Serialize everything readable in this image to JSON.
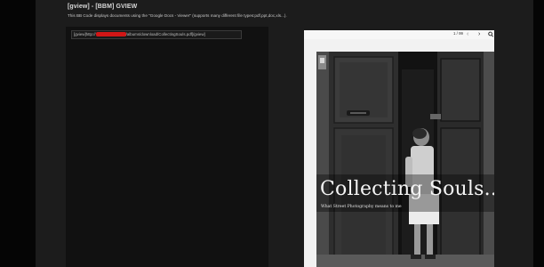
{
  "header": {
    "title": "[gview] - [BBM] GVIEW",
    "description": "This BB Code displays documents using the \"Google Docs - Viewer\" (supports many different file types:pdf,ppt,doc,xls...)."
  },
  "code_example": {
    "prefix": "[gview]http://",
    "suffix": "/albums/download/CollectingSouls.pdf[/gview]"
  },
  "viewer": {
    "page_count": "1 / 99",
    "prev_icon": "chevron-left-icon",
    "next_icon": "chevron-right-icon",
    "zoom_icon": "magnifier-icon"
  },
  "document": {
    "cover_title": "Collecting Souls..",
    "cover_subtitle": "What Street Photography means to me"
  },
  "colors": {
    "page_bg": "#1c1c1c",
    "redaction": "#d11616",
    "viewer_bg": "#f2f2f2"
  }
}
